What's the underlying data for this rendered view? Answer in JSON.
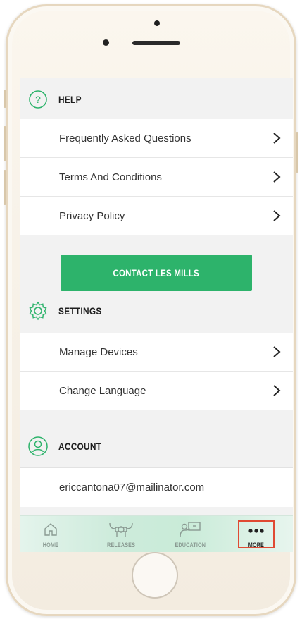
{
  "help": {
    "title": "HELP",
    "items": [
      {
        "label": "Frequently Asked Questions"
      },
      {
        "label": "Terms And Conditions"
      },
      {
        "label": "Privacy Policy"
      }
    ],
    "contact_button": "CONTACT LES MILLS"
  },
  "settings": {
    "title": "SETTINGS",
    "items": [
      {
        "label": "Manage Devices"
      },
      {
        "label": "Change Language"
      }
    ]
  },
  "account": {
    "title": "ACCOUNT",
    "email": "ericcantona07@mailinator.com"
  },
  "tabbar": {
    "tabs": [
      {
        "label": "HOME",
        "icon": "home-icon"
      },
      {
        "label": "RELEASES",
        "icon": "releases-icon"
      },
      {
        "label": "EDUCATION",
        "icon": "education-icon"
      },
      {
        "label": "MORE",
        "icon": "more-icon",
        "active": true
      }
    ]
  },
  "colors": {
    "accent_green": "#2db36b",
    "highlight_red": "#e04a33"
  }
}
